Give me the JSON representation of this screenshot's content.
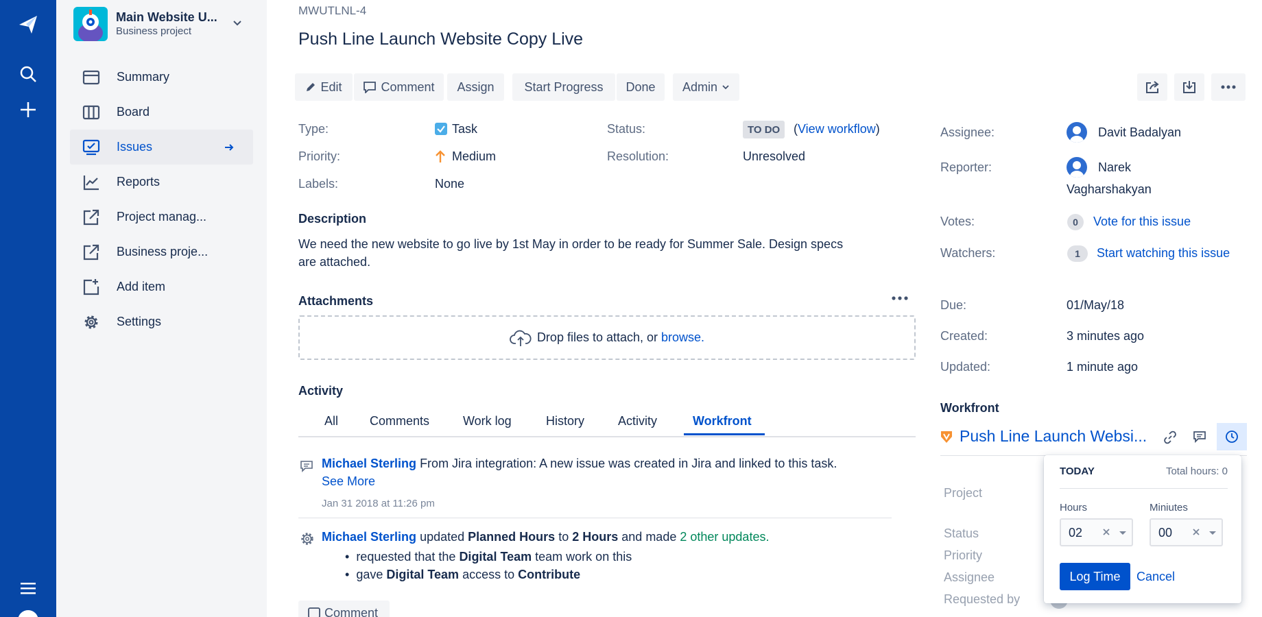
{
  "nav": {
    "logo_icon": "jira-logo-icon",
    "search_icon": "search-icon",
    "create_icon": "plus-icon",
    "menu_icon": "hamburger-icon"
  },
  "project": {
    "name": "Main Website U...",
    "type": "Business project"
  },
  "sidebar": {
    "items": [
      {
        "label": "Summary",
        "icon": "summary-icon"
      },
      {
        "label": "Board",
        "icon": "board-icon"
      },
      {
        "label": "Issues",
        "icon": "issues-icon"
      },
      {
        "label": "Reports",
        "icon": "reports-icon"
      },
      {
        "label": "Project manag...",
        "icon": "external-link-icon"
      },
      {
        "label": "Business proje...",
        "icon": "external-link-icon"
      },
      {
        "label": "Add item",
        "icon": "add-item-icon"
      },
      {
        "label": "Settings",
        "icon": "gear-icon"
      }
    ]
  },
  "issue": {
    "key": "MWUTLNL-4",
    "title": "Push Line Launch Website Copy Live"
  },
  "toolbar": {
    "edit": "Edit",
    "comment": "Comment",
    "assign": "Assign",
    "start_progress": "Start Progress",
    "done": "Done",
    "admin": "Admin"
  },
  "details": {
    "type_label": "Type:",
    "type_value": "Task",
    "priority_label": "Priority:",
    "priority_value": "Medium",
    "labels_label": "Labels:",
    "labels_value": "None",
    "status_label": "Status:",
    "status_value": "TO DO",
    "view_workflow": "View workflow",
    "resolution_label": "Resolution:",
    "resolution_value": "Unresolved"
  },
  "description": {
    "heading": "Description",
    "text_line1": "We need the new website to go live by 1st May in order to be ready for Summer Sale. Design specs",
    "text_line2": "are attached."
  },
  "attachments": {
    "heading": "Attachments",
    "drop_text": "Drop files to attach, or",
    "browse": "browse."
  },
  "activity": {
    "heading": "Activity",
    "tabs": [
      "All",
      "Comments",
      "Work log",
      "History",
      "Activity",
      "Workfront"
    ],
    "active_tab": "Workfront",
    "entries": [
      {
        "author": "Michael Sterling",
        "text": "From Jira integration: A new issue was created in Jira and linked to this task.",
        "see_more": "See More",
        "date": "Jan 31 2018 at 11:26 pm"
      },
      {
        "author": "Michael Sterling",
        "t1": "updated",
        "t2": "Planned Hours",
        "t3": "to",
        "t4": "2 Hours",
        "t5": "and made",
        "other_updates": "2 other updates.",
        "bullets": [
          {
            "a": "requested that the",
            "b": "Digital Team",
            "c": "team work on this"
          },
          {
            "a": "gave",
            "b": "Digital Team",
            "c": "access to",
            "d": "Contribute"
          }
        ]
      }
    ],
    "comment_button": "Comment"
  },
  "people": {
    "assignee_label": "Assignee:",
    "assignee": "Davit Badalyan",
    "reporter_label": "Reporter:",
    "reporter_first": "Narek",
    "reporter_last": "Vagharshakyan",
    "votes_label": "Votes:",
    "votes_count": "0",
    "vote_link": "Vote for this issue",
    "watchers_label": "Watchers:",
    "watchers_count": "1",
    "watch_link": "Start watching this issue"
  },
  "dates": {
    "due_label": "Due:",
    "due": "01/May/18",
    "created_label": "Created:",
    "created": "3 minutes ago",
    "updated_label": "Updated:",
    "updated": "1 minute ago"
  },
  "workfront": {
    "heading": "Workfront",
    "task_title": "Push Line Launch Websi...",
    "labels": [
      "Project",
      "Status",
      "Priority",
      "Assignee",
      "Requested by"
    ]
  },
  "logtime": {
    "today": "TODAY",
    "total": "Total hours: 0",
    "hours_label": "Hours",
    "hours_value": "02",
    "minutes_label": "Miniutes",
    "minutes_value": "00",
    "log_button": "Log Time",
    "cancel": "Cancel"
  },
  "colors": {
    "nav_bg": "#0747a6",
    "link": "#0052cc",
    "accent_orange": "#f79232",
    "green": "#00875a"
  }
}
